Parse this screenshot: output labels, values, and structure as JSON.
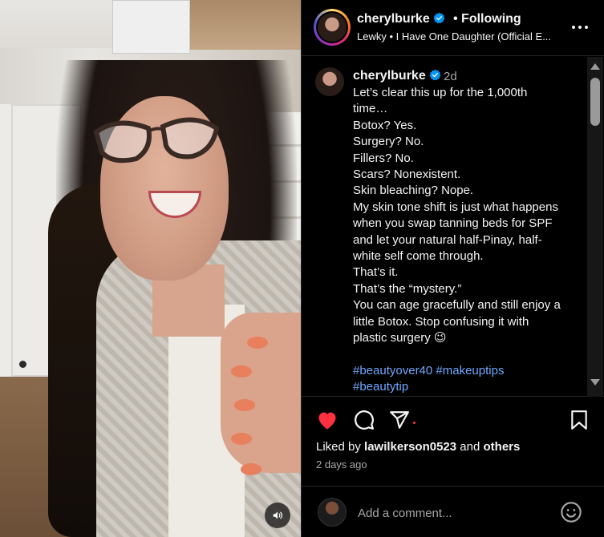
{
  "post": {
    "author": "cherylburke",
    "header_following": "• Following",
    "audio": "Lewky • I Have One Daughter (Official E...",
    "caption_time": "2d",
    "caption_lines": [
      "Let’s clear this up for the 1,000th",
      "time…",
      "Botox? Yes.",
      "Surgery? No.",
      "Fillers? No.",
      "Scars? Nonexistent.",
      "Skin bleaching? Nope.",
      "My skin tone shift is just what happens",
      "when you swap tanning beds for SPF",
      "and let your natural half-Pinay, half-",
      "white self come through.",
      "That’s it.",
      "That’s the “mystery.”",
      "You can age gracefully and still enjoy a",
      "little Botox. Stop confusing it with",
      "plastic surgery 😉"
    ],
    "hashtags_line1": "#beautyover40 #makeuptips",
    "hashtags_line2": "#beautytip",
    "liked_by_prefix": "Liked by ",
    "liked_by_user": "lawilkerson0523",
    "liked_by_and": " and ",
    "liked_by_others": "others",
    "date": "2 days ago",
    "comment_placeholder": "Add a comment...",
    "liked": true
  },
  "colors": {
    "background": "#000000",
    "text": "#f5f5f5",
    "secondary_text": "#a8a8a8",
    "verified_blue": "#0095f6",
    "hashtag": "#6fa8ff",
    "like_red": "#ff3040",
    "divider": "#262626"
  },
  "icons": {
    "verified": "verified-badge-icon",
    "more": "more-options-icon",
    "like": "heart-filled-icon",
    "comment": "comment-bubble-icon",
    "share": "paper-plane-icon",
    "save": "bookmark-icon",
    "mute": "speaker-icon",
    "emoji": "smiley-icon"
  }
}
